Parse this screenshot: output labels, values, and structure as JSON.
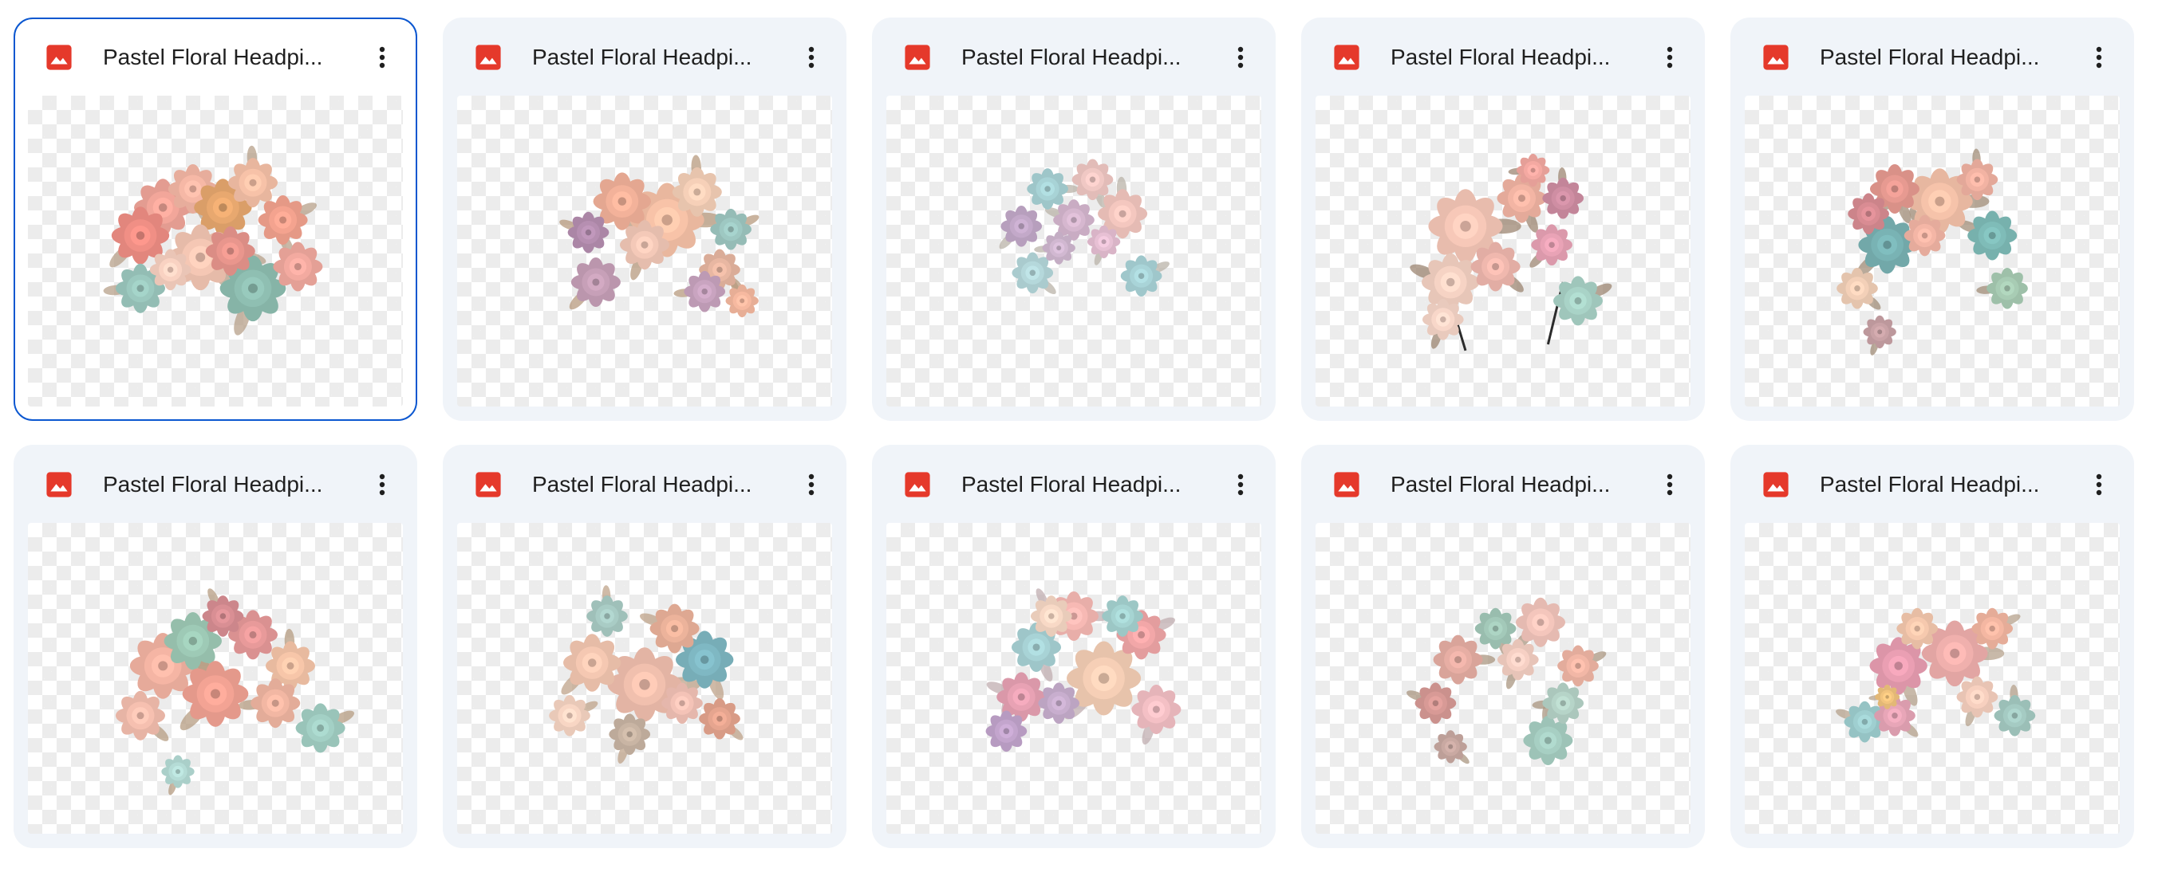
{
  "files": [
    {
      "name": "Pastel Floral Headpiece",
      "display_name": "Pastel Floral Headpi...",
      "icon": "image-file-icon",
      "selected": true,
      "flowers": [
        [
          "#f2a69a",
          0.36,
          0.36,
          0.07
        ],
        [
          "#f6b8a6",
          0.44,
          0.3,
          0.06
        ],
        [
          "#f08f85",
          0.3,
          0.45,
          0.07
        ],
        [
          "#e8a86f",
          0.52,
          0.36,
          0.07
        ],
        [
          "#f7c2a8",
          0.6,
          0.28,
          0.06
        ],
        [
          "#f4a38f",
          0.68,
          0.4,
          0.06
        ],
        [
          "#f5c7b4",
          0.46,
          0.52,
          0.08
        ],
        [
          "#8fbfb2",
          0.6,
          0.62,
          0.08
        ],
        [
          "#9cc9bf",
          0.3,
          0.62,
          0.06
        ],
        [
          "#f3aaa0",
          0.72,
          0.55,
          0.06
        ],
        [
          "#f9d2c2",
          0.38,
          0.56,
          0.05
        ],
        [
          "#e9968d",
          0.54,
          0.5,
          0.06
        ]
      ],
      "leaf": "#b7a08a"
    },
    {
      "name": "Pastel Floral Headpiece",
      "display_name": "Pastel Floral Headpi...",
      "icon": "image-file-icon",
      "selected": false,
      "flowers": [
        [
          "#f8c3a8",
          0.56,
          0.4,
          0.09
        ],
        [
          "#f3b29a",
          0.44,
          0.34,
          0.07
        ],
        [
          "#c7a0b8",
          0.37,
          0.6,
          0.06
        ],
        [
          "#b68fb1",
          0.35,
          0.44,
          0.05
        ],
        [
          "#f6d0b8",
          0.64,
          0.31,
          0.06
        ],
        [
          "#9ec8c2",
          0.73,
          0.43,
          0.05
        ],
        [
          "#e8b7a2",
          0.7,
          0.56,
          0.05
        ],
        [
          "#f4c9b8",
          0.5,
          0.48,
          0.06
        ],
        [
          "#c9a4c0",
          0.66,
          0.63,
          0.05
        ],
        [
          "#f6b9a0",
          0.76,
          0.66,
          0.04
        ]
      ],
      "leaf": "#b79a7e"
    },
    {
      "name": "Pastel Floral Headpiece",
      "display_name": "Pastel Floral Headpi...",
      "icon": "image-file-icon",
      "selected": false,
      "flowers": [
        [
          "#a8d3d6",
          0.43,
          0.3,
          0.05
        ],
        [
          "#f0c8c4",
          0.55,
          0.27,
          0.05
        ],
        [
          "#c3a9c9",
          0.36,
          0.42,
          0.05
        ],
        [
          "#d6b7cf",
          0.5,
          0.4,
          0.05
        ],
        [
          "#f4c7bf",
          0.63,
          0.38,
          0.06
        ],
        [
          "#a9d4d8",
          0.68,
          0.58,
          0.05
        ],
        [
          "#b5d8db",
          0.39,
          0.57,
          0.05
        ],
        [
          "#e7c0d4",
          0.58,
          0.47,
          0.04
        ],
        [
          "#d1b8d1",
          0.46,
          0.49,
          0.04
        ]
      ],
      "leaf": "#b9b3a8"
    },
    {
      "name": "Pastel Floral Headpiece",
      "display_name": "Pastel Floral Headpi...",
      "icon": "image-file-icon",
      "selected": false,
      "flowers": [
        [
          "#f7c8b8",
          0.4,
          0.42,
          0.09
        ],
        [
          "#f3b5a4",
          0.55,
          0.33,
          0.06
        ],
        [
          "#e9a3b6",
          0.63,
          0.48,
          0.05
        ],
        [
          "#f6d3c4",
          0.36,
          0.6,
          0.07
        ],
        [
          "#cf8ea3",
          0.66,
          0.33,
          0.05
        ],
        [
          "#a9d3c7",
          0.7,
          0.66,
          0.06
        ],
        [
          "#f0b8ae",
          0.48,
          0.55,
          0.06
        ],
        [
          "#f8d7c9",
          0.34,
          0.72,
          0.05
        ],
        [
          "#f4a9a2",
          0.58,
          0.24,
          0.04
        ]
      ],
      "leaf": "#9c8672",
      "stems": true
    },
    {
      "name": "Pastel Floral Headpiece",
      "display_name": "Pastel Floral Headpi...",
      "icon": "image-file-icon",
      "selected": false,
      "flowers": [
        [
          "#f6c3aa",
          0.52,
          0.34,
          0.08
        ],
        [
          "#e79a91",
          0.4,
          0.3,
          0.06
        ],
        [
          "#79b3b4",
          0.38,
          0.48,
          0.07
        ],
        [
          "#7fbcb8",
          0.66,
          0.45,
          0.06
        ],
        [
          "#f2b3a3",
          0.62,
          0.27,
          0.05
        ],
        [
          "#d98c93",
          0.33,
          0.38,
          0.05
        ],
        [
          "#f3d0b8",
          0.3,
          0.62,
          0.05
        ],
        [
          "#c9a2a6",
          0.36,
          0.76,
          0.04
        ],
        [
          "#a8ccb4",
          0.7,
          0.62,
          0.05
        ],
        [
          "#f4b6a6",
          0.48,
          0.45,
          0.05
        ]
      ],
      "leaf": "#a18e78"
    },
    {
      "name": "Pastel Floral Headpiece",
      "display_name": "Pastel Floral Headpi...",
      "icon": "image-file-icon",
      "selected": false,
      "flowers": [
        [
          "#f5b5a4",
          0.36,
          0.46,
          0.08
        ],
        [
          "#9ecab6",
          0.44,
          0.38,
          0.07
        ],
        [
          "#f3a394",
          0.5,
          0.55,
          0.08
        ],
        [
          "#e89a9a",
          0.6,
          0.36,
          0.06
        ],
        [
          "#f7c6a9",
          0.7,
          0.46,
          0.06
        ],
        [
          "#a3d0c5",
          0.78,
          0.66,
          0.06
        ],
        [
          "#f6c0b0",
          0.3,
          0.62,
          0.06
        ],
        [
          "#b5dcd6",
          0.4,
          0.8,
          0.04
        ],
        [
          "#f2b7a3",
          0.66,
          0.58,
          0.06
        ],
        [
          "#d98f94",
          0.52,
          0.3,
          0.05
        ]
      ],
      "leaf": "#b59c82"
    },
    {
      "name": "Pastel Floral Headpiece",
      "display_name": "Pastel Floral Headpi...",
      "icon": "image-file-icon",
      "selected": false,
      "flowers": [
        [
          "#f1c0ae",
          0.5,
          0.52,
          0.09
        ],
        [
          "#7fb8c3",
          0.66,
          0.44,
          0.07
        ],
        [
          "#f5c8b2",
          0.36,
          0.45,
          0.07
        ],
        [
          "#ecb39b",
          0.58,
          0.34,
          0.06
        ],
        [
          "#a9ccc5",
          0.4,
          0.3,
          0.05
        ],
        [
          "#f8d6c4",
          0.3,
          0.62,
          0.05
        ],
        [
          "#e6a58f",
          0.7,
          0.63,
          0.05
        ],
        [
          "#c9b5a4",
          0.46,
          0.68,
          0.05
        ],
        [
          "#f4c3b7",
          0.6,
          0.58,
          0.05
        ]
      ],
      "leaf": "#bfa38a"
    },
    {
      "name": "Pastel Floral Headpiece",
      "display_name": "Pastel Floral Headpi...",
      "icon": "image-file-icon",
      "selected": false,
      "flowers": [
        [
          "#f7b9b4",
          0.5,
          0.3,
          0.06
        ],
        [
          "#a8d3d6",
          0.4,
          0.4,
          0.06
        ],
        [
          "#f6cfb6",
          0.58,
          0.5,
          0.09
        ],
        [
          "#e8a2b4",
          0.36,
          0.56,
          0.06
        ],
        [
          "#c3a5cd",
          0.32,
          0.67,
          0.05
        ],
        [
          "#f2a7a8",
          0.68,
          0.36,
          0.06
        ],
        [
          "#a6d4d2",
          0.63,
          0.3,
          0.05
        ],
        [
          "#f4c0c5",
          0.72,
          0.6,
          0.06
        ],
        [
          "#c8aece",
          0.46,
          0.58,
          0.05
        ],
        [
          "#f8d9c6",
          0.44,
          0.3,
          0.05
        ]
      ],
      "leaf": "#c0aeb0"
    },
    {
      "name": "Pastel Floral Headpiece",
      "display_name": "Pastel Floral Headpi...",
      "icon": "image-file-icon",
      "selected": false,
      "flowers": [
        [
          "#e7aea4",
          0.38,
          0.44,
          0.06
        ],
        [
          "#a3c9b9",
          0.48,
          0.34,
          0.05
        ],
        [
          "#f4c6bc",
          0.6,
          0.32,
          0.06
        ],
        [
          "#d89a96",
          0.32,
          0.58,
          0.05
        ],
        [
          "#a7cfc3",
          0.62,
          0.7,
          0.06
        ],
        [
          "#f2b7a6",
          0.7,
          0.46,
          0.05
        ],
        [
          "#c9a9a2",
          0.36,
          0.72,
          0.04
        ],
        [
          "#f6d0c4",
          0.54,
          0.44,
          0.05
        ],
        [
          "#b6d4c8",
          0.66,
          0.58,
          0.05
        ]
      ],
      "leaf": "#a99580"
    },
    {
      "name": "Pastel Floral Headpiece",
      "display_name": "Pastel Floral Headpi...",
      "icon": "image-file-icon",
      "selected": false,
      "flowers": [
        [
          "#f0b0ad",
          0.56,
          0.42,
          0.08
        ],
        [
          "#ea9fb3",
          0.41,
          0.46,
          0.07
        ],
        [
          "#f6c9ae",
          0.46,
          0.34,
          0.05
        ],
        [
          "#9fcfd0",
          0.32,
          0.64,
          0.05
        ],
        [
          "#a5cbc3",
          0.72,
          0.62,
          0.05
        ],
        [
          "#f4b7a2",
          0.66,
          0.34,
          0.05
        ],
        [
          "#e8a6b8",
          0.4,
          0.62,
          0.05
        ],
        [
          "#f7d0bf",
          0.62,
          0.56,
          0.05
        ],
        [
          "#f2c47e",
          0.38,
          0.56,
          0.03
        ]
      ],
      "leaf": "#b6a28c"
    }
  ]
}
